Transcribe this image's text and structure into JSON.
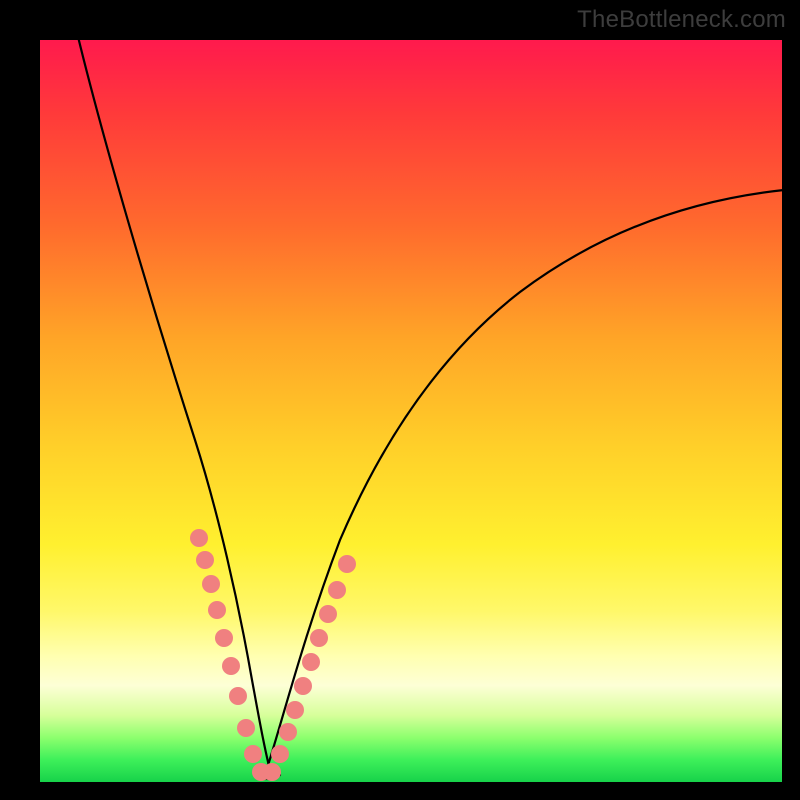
{
  "watermark": "TheBottleneck.com",
  "chart_data": {
    "type": "line",
    "title": "",
    "xlabel": "",
    "ylabel": "",
    "xlim": [
      0,
      100
    ],
    "ylim": [
      0,
      100
    ],
    "grid": false,
    "legend": null,
    "annotations": [
      {
        "text": "TheBottleneck.com",
        "position": "top-right"
      }
    ],
    "background_gradient": {
      "direction": "vertical",
      "stops": [
        {
          "pos": 0,
          "color": "#ff1a4d"
        },
        {
          "pos": 25,
          "color": "#ff6a2d"
        },
        {
          "pos": 55,
          "color": "#ffd029"
        },
        {
          "pos": 83,
          "color": "#ffffb0"
        },
        {
          "pos": 100,
          "color": "#17d24a"
        }
      ]
    },
    "series": [
      {
        "name": "bottleneck-curve",
        "description": "V-shaped bottleneck curve; y ≈ 100 at edges, drops to ~0 near x ≈ 30, steeper on the left arm",
        "x": [
          5,
          10,
          15,
          20,
          22,
          24,
          26,
          28,
          30,
          32,
          34,
          36,
          40,
          45,
          50,
          55,
          60,
          70,
          80,
          90,
          100
        ],
        "y": [
          100,
          83,
          66,
          47,
          38,
          28,
          17,
          7,
          0,
          2,
          8,
          15,
          27,
          38,
          47,
          53,
          58,
          66,
          72,
          76,
          79
        ]
      }
    ],
    "highlight_points": {
      "name": "sample-dots",
      "color": "#f08080",
      "x": [
        20.5,
        21.5,
        22.4,
        23.2,
        24.0,
        24.9,
        25.8,
        26.8,
        27.8,
        29.0,
        30.4,
        31.6,
        32.6,
        33.4,
        34.4,
        35.4,
        36.3,
        37.3,
        38.3,
        39.4
      ],
      "y": [
        45,
        41,
        37,
        33,
        28,
        24,
        19,
        13,
        8,
        2,
        2,
        6,
        10,
        13,
        17,
        20,
        24,
        27,
        30,
        33
      ]
    }
  }
}
